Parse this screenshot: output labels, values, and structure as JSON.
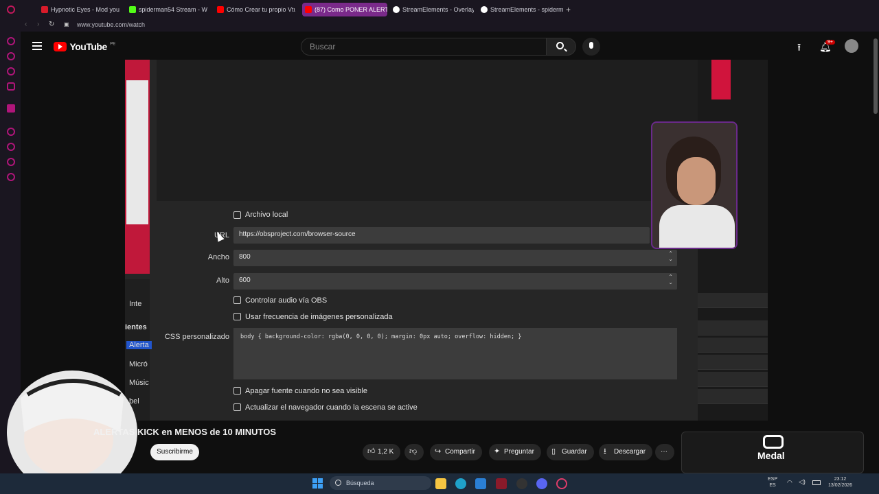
{
  "browser": {
    "tabs": [
      {
        "label": "Hypnotic Eyes - Mod your",
        "icon_color": "#d81b2a"
      },
      {
        "label": "spiderman54 Stream - Wi",
        "icon_color": "#53fc18"
      },
      {
        "label": "Cómo Crear tu propio Vtu",
        "icon_color": "#ff0000"
      },
      {
        "label": "(87) Como PONER ALERT",
        "icon_color": "#ff0000"
      },
      {
        "label": "StreamElements - Overlay",
        "icon_color": "#ffffff"
      },
      {
        "label": "StreamElements - spiderm",
        "icon_color": "#ffffff"
      }
    ],
    "url": "www.youtube.com/watch"
  },
  "youtube": {
    "logo_text": "YouTube",
    "logo_badge": "PE",
    "search_placeholder": "Buscar",
    "notif_badge": "9+"
  },
  "obs": {
    "archivo_local": "Archivo local",
    "url_label": "URL",
    "url_value": "https://obsproject.com/browser-source",
    "ancho_label": "Ancho",
    "ancho_value": "800",
    "alto_label": "Alto",
    "alto_value": "600",
    "controlar_audio": "Controlar audio vía OBS",
    "usar_frecuencia": "Usar frecuencia de imágenes personalizada",
    "css_label": "CSS personalizado",
    "css_value": "body { background-color: rgba(0, 0, 0, 0); margin: 0px auto; overflow: hidden; }",
    "apagar_fuente": "Apagar fuente cuando no sea visible",
    "actualizar_nav": "Actualizar el navegador cuando la escena se active",
    "left_items": [
      "Inte",
      "ientes",
      "Alerta",
      "Micró",
      "Músic",
      "bel"
    ]
  },
  "video": {
    "title": "ALERTAS KICK en MENOS de 10 MINUTOS",
    "subscribe_label": "Suscribirme",
    "actions": {
      "likes": "1,2 K",
      "share": "Compartir",
      "ask": "Preguntar",
      "save": "Guardar",
      "download": "Descargar"
    }
  },
  "medal": {
    "label": "Medal"
  },
  "taskbar": {
    "search_placeholder": "Búsqueda",
    "lang_top": "ESP",
    "lang_bottom": "ES",
    "time": "23:12",
    "date": "13/02/2026"
  }
}
